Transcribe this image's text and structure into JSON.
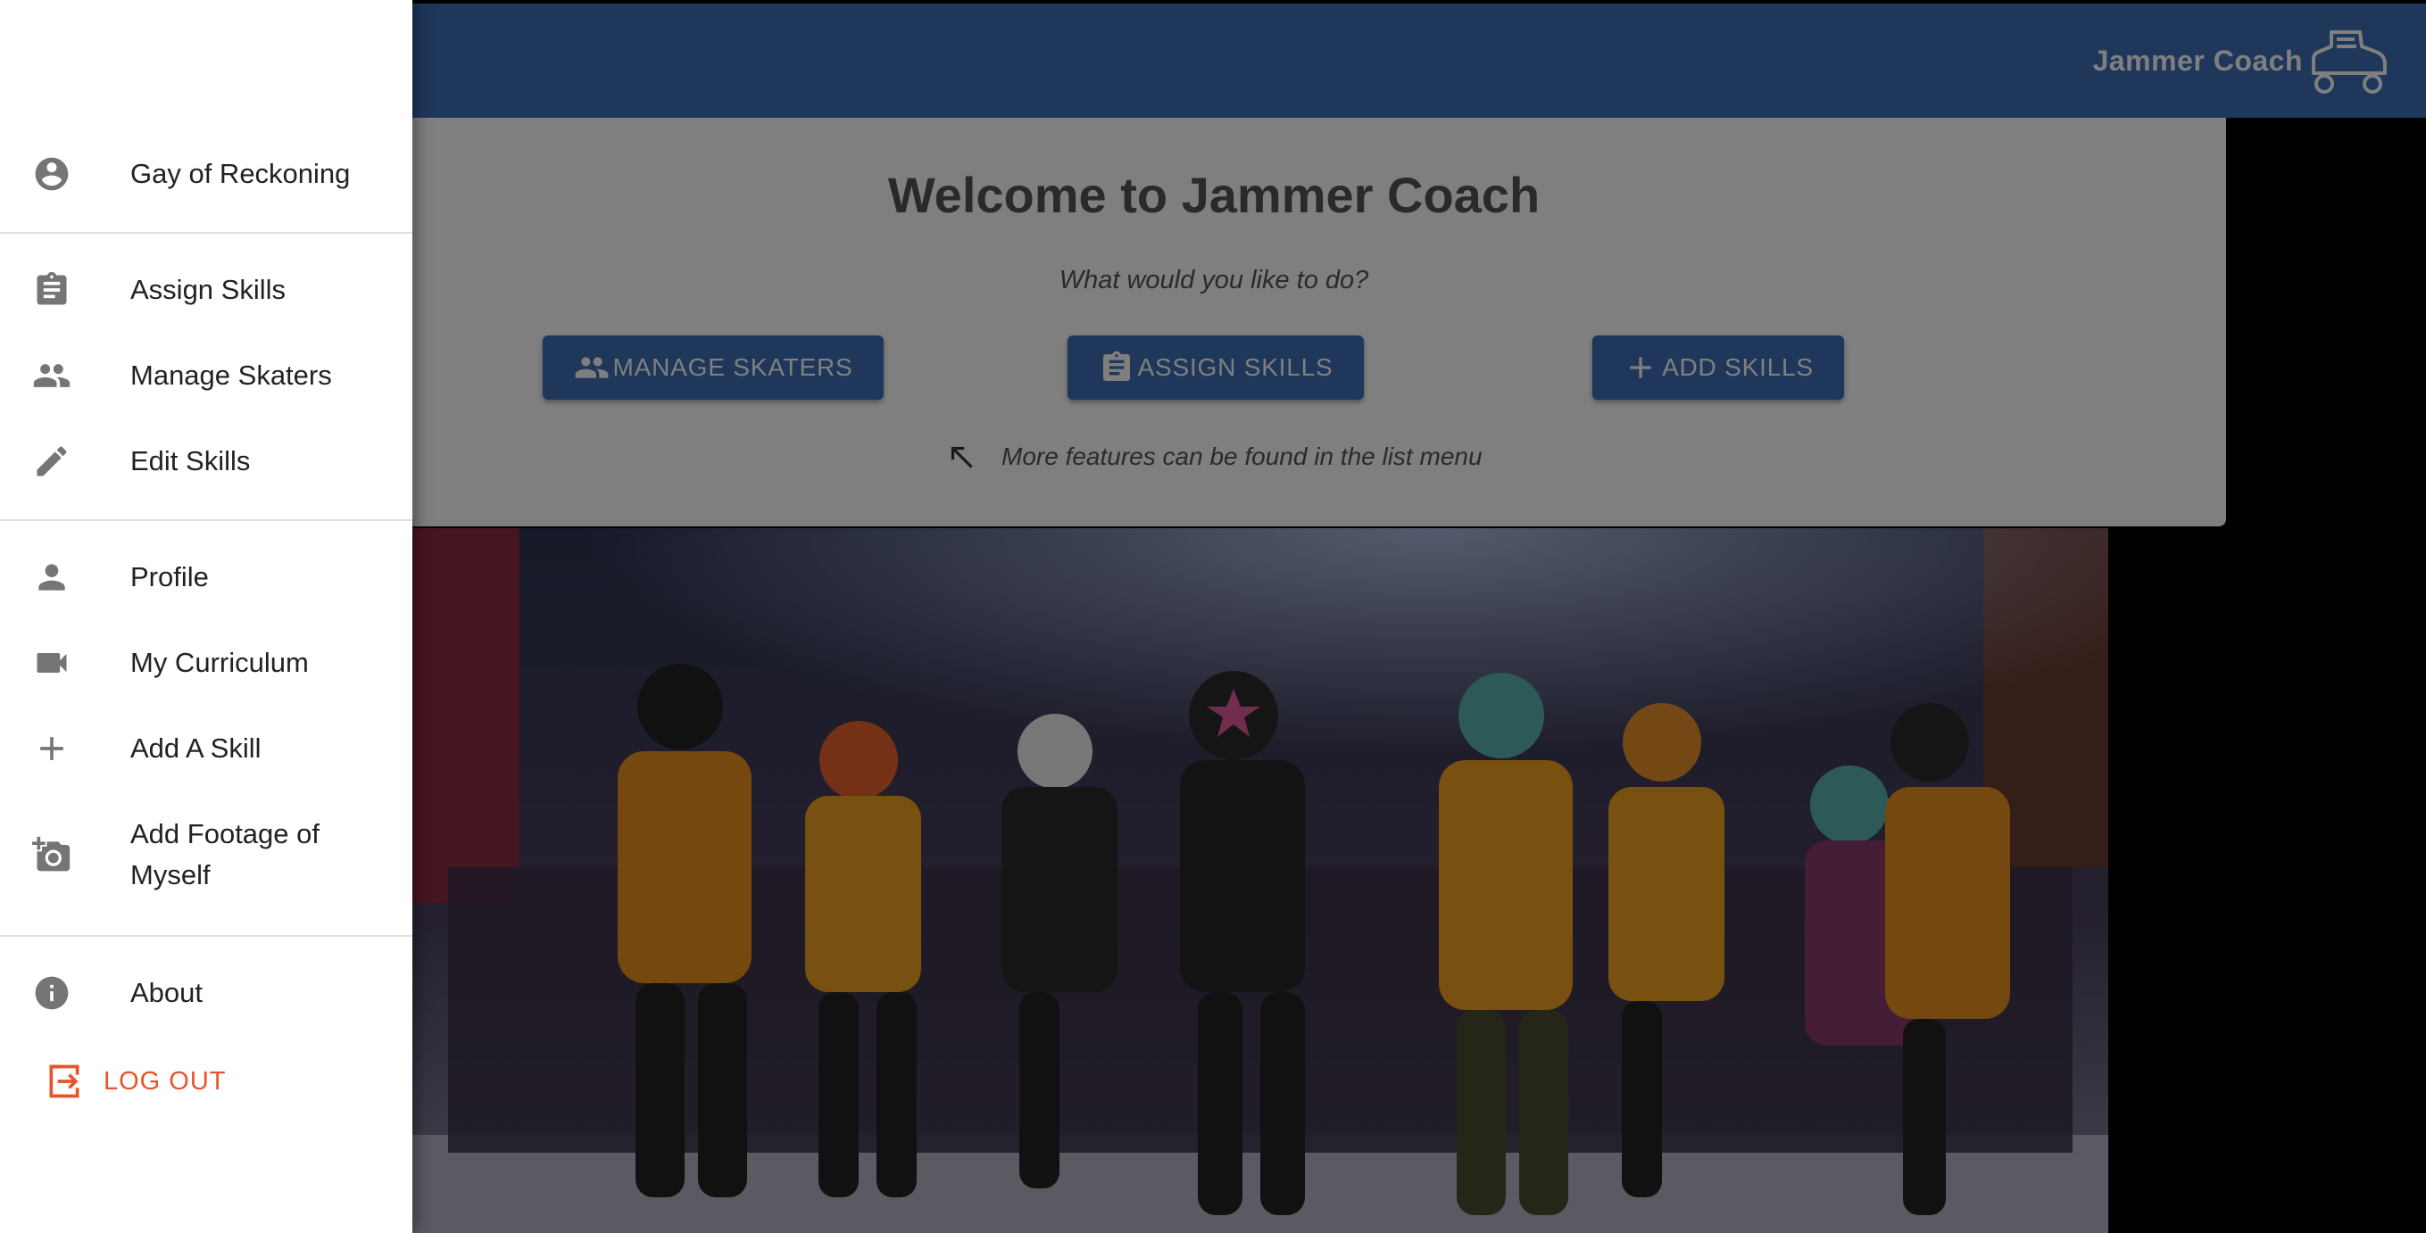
{
  "appbar": {
    "title": "Jammer Coach",
    "logo_icon": "roller-skate-icon",
    "color": "#3c6fb5"
  },
  "welcome": {
    "title": "Welcome to Jammer Coach",
    "question": "What would you like to do?",
    "buttons": [
      {
        "label": "MANAGE SKATERS",
        "icon": "people-icon"
      },
      {
        "label": "ASSIGN SKILLS",
        "icon": "clipboard-icon"
      },
      {
        "label": "ADD SKILLS",
        "icon": "plus-icon"
      }
    ],
    "hint": "More features can be found in the list menu"
  },
  "drawer": {
    "user": {
      "name": "Gay of Reckoning",
      "icon": "account-circle-icon"
    },
    "group1": [
      {
        "label": "Assign Skills",
        "icon": "clipboard-icon"
      },
      {
        "label": "Manage Skaters",
        "icon": "people-icon"
      },
      {
        "label": "Edit Skills",
        "icon": "pencil-icon"
      }
    ],
    "group2": [
      {
        "label": "Profile",
        "icon": "person-icon"
      },
      {
        "label": "My Curriculum",
        "icon": "videocam-icon"
      },
      {
        "label": "Add A Skill",
        "icon": "plus-icon"
      },
      {
        "label": "Add Footage of Myself",
        "icon": "add-photo-icon"
      }
    ],
    "about": {
      "label": "About",
      "icon": "info-icon"
    },
    "logout": {
      "label": "LOG OUT",
      "icon": "logout-icon",
      "color": "#e8532b"
    }
  },
  "photo": {
    "description_icon": "roller-derby-photo"
  }
}
